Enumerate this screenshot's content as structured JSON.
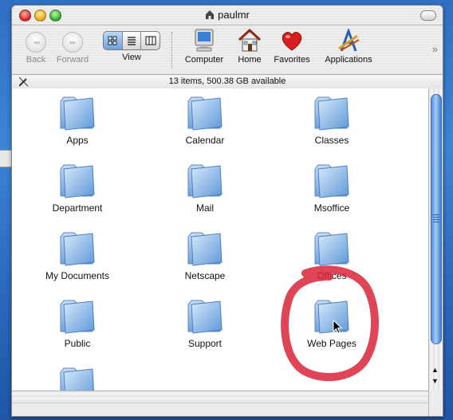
{
  "window": {
    "title": "paulmr"
  },
  "toolbar": {
    "back_label": "Back",
    "forward_label": "Forward",
    "view_label": "View",
    "view_selected": "icon",
    "computer_label": "Computer",
    "home_label": "Home",
    "favorites_label": "Favorites",
    "applications_label": "Applications",
    "more_glyph": "»"
  },
  "status": {
    "text": "13 items, 500.38 GB available"
  },
  "items": [
    {
      "label": "Apps"
    },
    {
      "label": "Calendar"
    },
    {
      "label": "Classes"
    },
    {
      "label": "Department"
    },
    {
      "label": "Mail"
    },
    {
      "label": "Msoffice"
    },
    {
      "label": "My Documents"
    },
    {
      "label": "Netscape"
    },
    {
      "label": "Offices"
    },
    {
      "label": "Public"
    },
    {
      "label": "Support"
    },
    {
      "label": "Web Pages"
    },
    {
      "label": ""
    }
  ],
  "annotation": {
    "color": "#d9243a",
    "target": "Web Pages"
  },
  "colors": {
    "desktop": "#2f6fc4",
    "folder": "#8fbbe8",
    "scroll_thumb": "#4e8fdc"
  }
}
